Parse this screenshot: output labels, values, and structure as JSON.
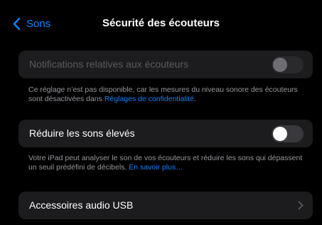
{
  "nav": {
    "back_label": "Sons",
    "title": "Sécurité des écouteurs"
  },
  "notifications": {
    "label": "Notifications relatives aux écouteurs",
    "enabled": false,
    "toggle_on": false
  },
  "notifications_footer": {
    "text": "Ce réglage n’est pas disponible, car les mesures du niveau sonore des écouteurs sont désactivées dans ",
    "link": "Réglages de confidentialité",
    "suffix": "."
  },
  "reduce_loud": {
    "label": "Réduire les sons élevés",
    "toggle_on": false
  },
  "reduce_footer": {
    "text": "Votre iPad peut analyser le son de vos écouteurs et réduire les sons qui dépassent un seuil prédéfini de décibels. ",
    "link": "En savoir plus…"
  },
  "usb": {
    "label": "Accessoires audio USB"
  },
  "colors": {
    "accent": "#0a84ff",
    "background": "#000000",
    "cell": "#1c1c1e"
  },
  "icons": {
    "back": "chevron-left-icon",
    "disclosure": "chevron-right-icon"
  }
}
